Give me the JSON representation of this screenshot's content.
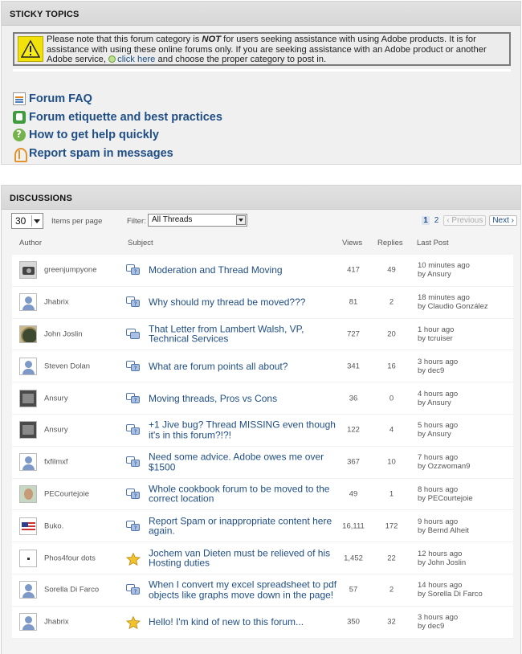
{
  "sticky": {
    "header": "STICKY TOPICS",
    "notice": {
      "text_before": "Please note that this forum category is ",
      "emphasis": "NOT",
      "text_middle": " for users seeking assistance with using Adobe products. It is for assistance with using these online forums only. If you are seeking assistance with an Adobe product or another Adobe service, ",
      "link": "click here",
      "text_after": " and choose the proper category to post in."
    },
    "items": [
      {
        "label": "Forum FAQ",
        "icon": "faq-icon"
      },
      {
        "label": "Forum etiquette and best practices",
        "icon": "etiquette-icon"
      },
      {
        "label": "How to get help quickly",
        "icon": "help-icon"
      },
      {
        "label": "Report spam in messages",
        "icon": "spam-icon"
      }
    ]
  },
  "discussions": {
    "header": "DISCUSSIONS",
    "items_per_page_value": "30",
    "items_per_page_label": "Items per page",
    "filter_label": "Filter:",
    "filter_value": "All Threads",
    "pager": {
      "page1": "1",
      "page2": "2",
      "previous": "Previous",
      "next": "Next"
    },
    "columns": {
      "author": "Author",
      "subject": "Subject",
      "views": "Views",
      "replies": "Replies",
      "last_post": "Last Post"
    },
    "threads": [
      {
        "author": "greenjumpyone",
        "avatar": "camera",
        "type": "question",
        "subject": "Moderation and Thread Moving",
        "views": "417",
        "replies": "49",
        "last_time": "10 minutes ago",
        "last_by": "by Ansury"
      },
      {
        "author": "Jhabrix",
        "avatar": "default",
        "type": "question",
        "subject": "Why should my thread be moved???",
        "views": "81",
        "replies": "2",
        "last_time": "18 minutes ago",
        "last_by": "by Claudio González"
      },
      {
        "author": "John Joslin",
        "avatar": "circle",
        "type": "discussion",
        "subject": "That Letter from Lambert Walsh, VP, Technical Services",
        "views": "727",
        "replies": "20",
        "last_time": "1 hour ago",
        "last_by": "by tcruiser"
      },
      {
        "author": "Steven Dolan",
        "avatar": "default",
        "type": "question",
        "subject": "What are forum points all about?",
        "views": "341",
        "replies": "16",
        "last_time": "3 hours ago",
        "last_by": "by dec9"
      },
      {
        "author": "Ansury",
        "avatar": "photo",
        "type": "question",
        "subject": "Moving threads, Pros vs Cons",
        "views": "36",
        "replies": "0",
        "last_time": "4 hours ago",
        "last_by": "by Ansury"
      },
      {
        "author": "Ansury",
        "avatar": "photo",
        "type": "question",
        "subject": "+1 Jive bug? Thread MISSING even though it's in this forum?!?!",
        "views": "122",
        "replies": "4",
        "last_time": "5 hours ago",
        "last_by": "by Ansury"
      },
      {
        "author": "fxfilmxf",
        "avatar": "default",
        "type": "question",
        "subject": "Need some advice. Adobe owes me over $1500",
        "views": "367",
        "replies": "10",
        "last_time": "7 hours ago",
        "last_by": "by Ozzwoman9"
      },
      {
        "author": "PECourtejoie",
        "avatar": "face",
        "type": "question",
        "subject": "Whole cookbook forum to be moved to the correct location",
        "views": "49",
        "replies": "1",
        "last_time": "8 hours ago",
        "last_by": "by PECourtejoie"
      },
      {
        "author": "Buko.",
        "avatar": "flag",
        "type": "question",
        "subject": "Report Spam or inappropriate content here again.",
        "views": "16,111",
        "replies": "172",
        "last_time": "9 hours ago",
        "last_by": "by Bernd Alheit"
      },
      {
        "author": "Phos4four dots",
        "avatar": "dot",
        "type": "star",
        "subject": "Jochem van Dieten must be relieved of his Hosting duties",
        "views": "1,452",
        "replies": "22",
        "last_time": "12 hours ago",
        "last_by": "by John Joslin"
      },
      {
        "author": "Sorella Di Farco",
        "avatar": "default",
        "type": "question",
        "subject": "When I convert my excel spreadsheet to pdf objects like graphs move down in the page!",
        "views": "57",
        "replies": "2",
        "last_time": "14 hours ago",
        "last_by": "by Sorella Di Farco"
      },
      {
        "author": "Jhabrix",
        "avatar": "default",
        "type": "star",
        "subject": "Hello! I'm kind of new to this forum...",
        "views": "350",
        "replies": "32",
        "last_time": "3 hours ago",
        "last_by": "by dec9"
      }
    ]
  }
}
